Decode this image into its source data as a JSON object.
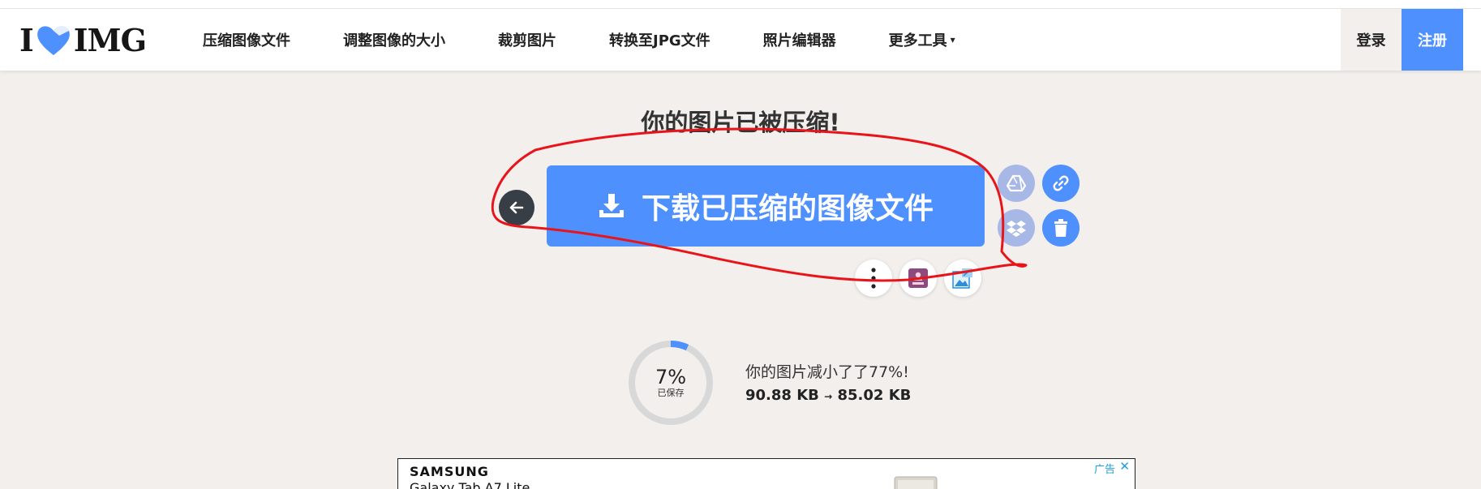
{
  "logo": {
    "left": "I",
    "right": "IMG"
  },
  "nav": {
    "items": [
      {
        "label": "压缩图像文件"
      },
      {
        "label": "调整图像的大小"
      },
      {
        "label": "裁剪图片"
      },
      {
        "label": "转换至JPG文件"
      },
      {
        "label": "照片编辑器"
      },
      {
        "label": "更多工具"
      }
    ],
    "more_caret": "▾",
    "login_label": "登录",
    "register_label": "注册"
  },
  "main": {
    "title": "你的图片已被压缩!",
    "download_label": "下载已压缩的图像文件",
    "icons": {
      "back": "arrow-left-icon",
      "drive": "google-drive-icon",
      "link": "link-icon",
      "dropbox": "dropbox-icon",
      "trash": "trash-icon",
      "more": "more-vertical-icon",
      "watermark": "stamp-icon",
      "edit": "image-edit-icon"
    }
  },
  "stats": {
    "percent": "7%",
    "percent_value": 0.07,
    "caption": "已保存",
    "reduced_text": "你的图片减小了了77%!",
    "size_from": "90.88 KB",
    "arrow": "→",
    "size_to": "85.02 KB"
  },
  "ad": {
    "brand": "SAMSUNG",
    "product": "Galaxy Tab A7 Lite",
    "label": "广告",
    "close": "✕"
  },
  "colors": {
    "accent": "#4d90fe",
    "background": "#f2efec",
    "annotation": "#e8141a"
  }
}
